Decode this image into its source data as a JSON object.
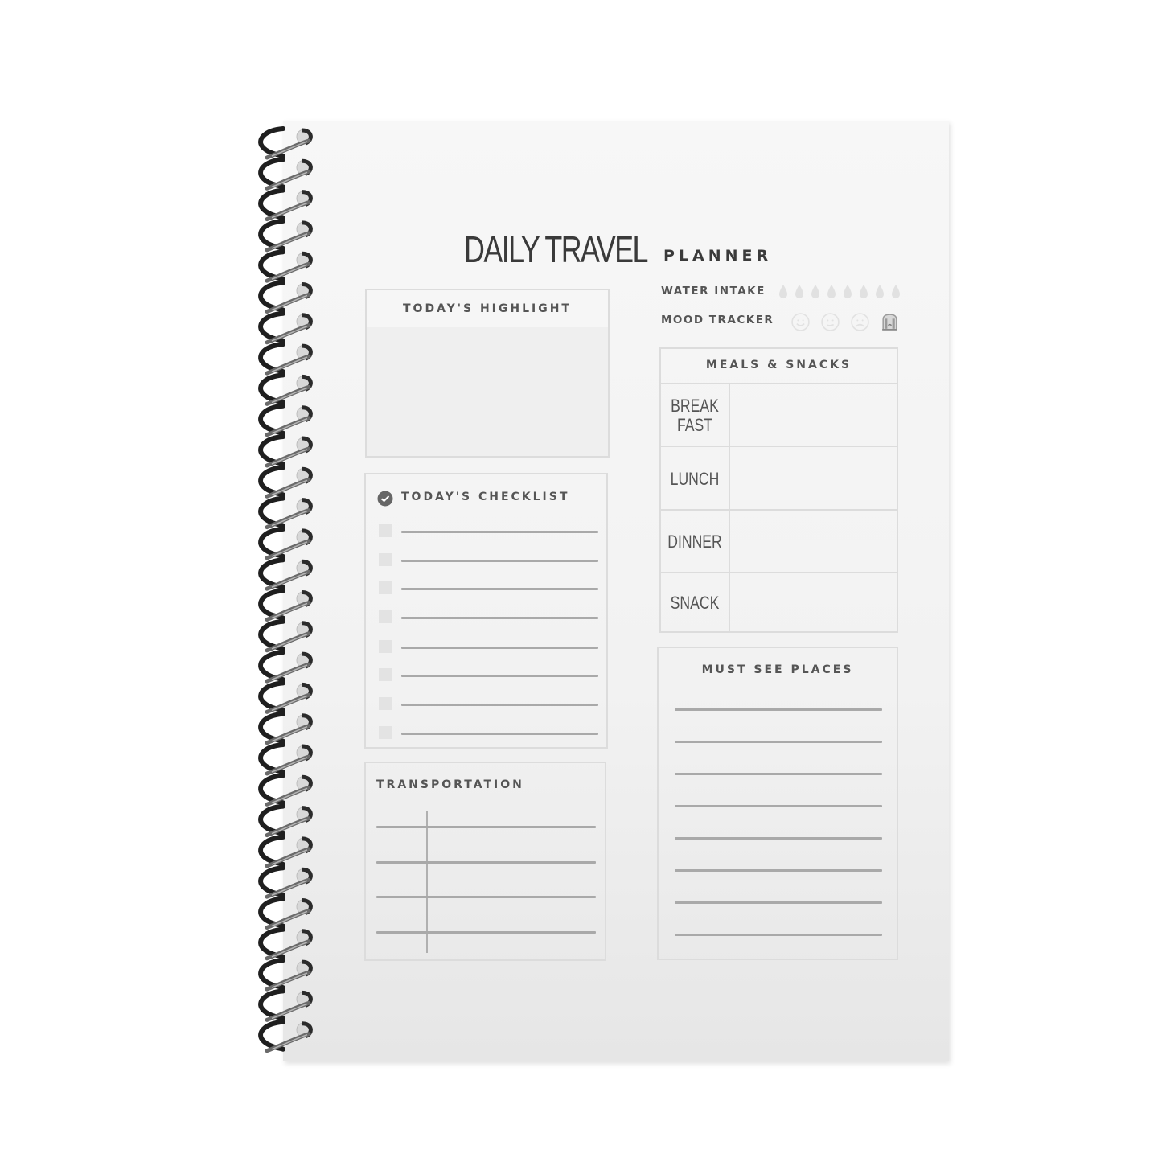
{
  "planner": {
    "title_main": "DAILY TRAVEL",
    "title_sub": "PLANNER",
    "trackers": {
      "water_label": "WATER INTAKE",
      "water_drops_count": 8,
      "mood_label": "MOOD TRACKER",
      "moods": [
        "happy",
        "neutral",
        "sad",
        "crying"
      ]
    },
    "highlight": {
      "title": "TODAY'S HIGHLIGHT"
    },
    "checklist": {
      "title": "TODAY'S CHECKLIST",
      "items_count": 8
    },
    "transportation": {
      "title": "TRANSPORTATION",
      "rows_count": 4
    },
    "meals": {
      "title": "MEALS & SNACKS",
      "rows": [
        {
          "label_line1": "BREAK",
          "label_line2": "FAST"
        },
        {
          "label_line1": "LUNCH",
          "label_line2": ""
        },
        {
          "label_line1": "DINNER",
          "label_line2": ""
        },
        {
          "label_line1": "SNACK",
          "label_line2": ""
        }
      ]
    },
    "must_see": {
      "title": "MUST SEE PLACES",
      "lines_count": 8
    }
  },
  "colors": {
    "page": "#f4f4f4",
    "ink": "#3a3a3a",
    "rule": "#a9a9a9",
    "border": "#dcdcdc",
    "spiral": "#2a2a2a"
  }
}
